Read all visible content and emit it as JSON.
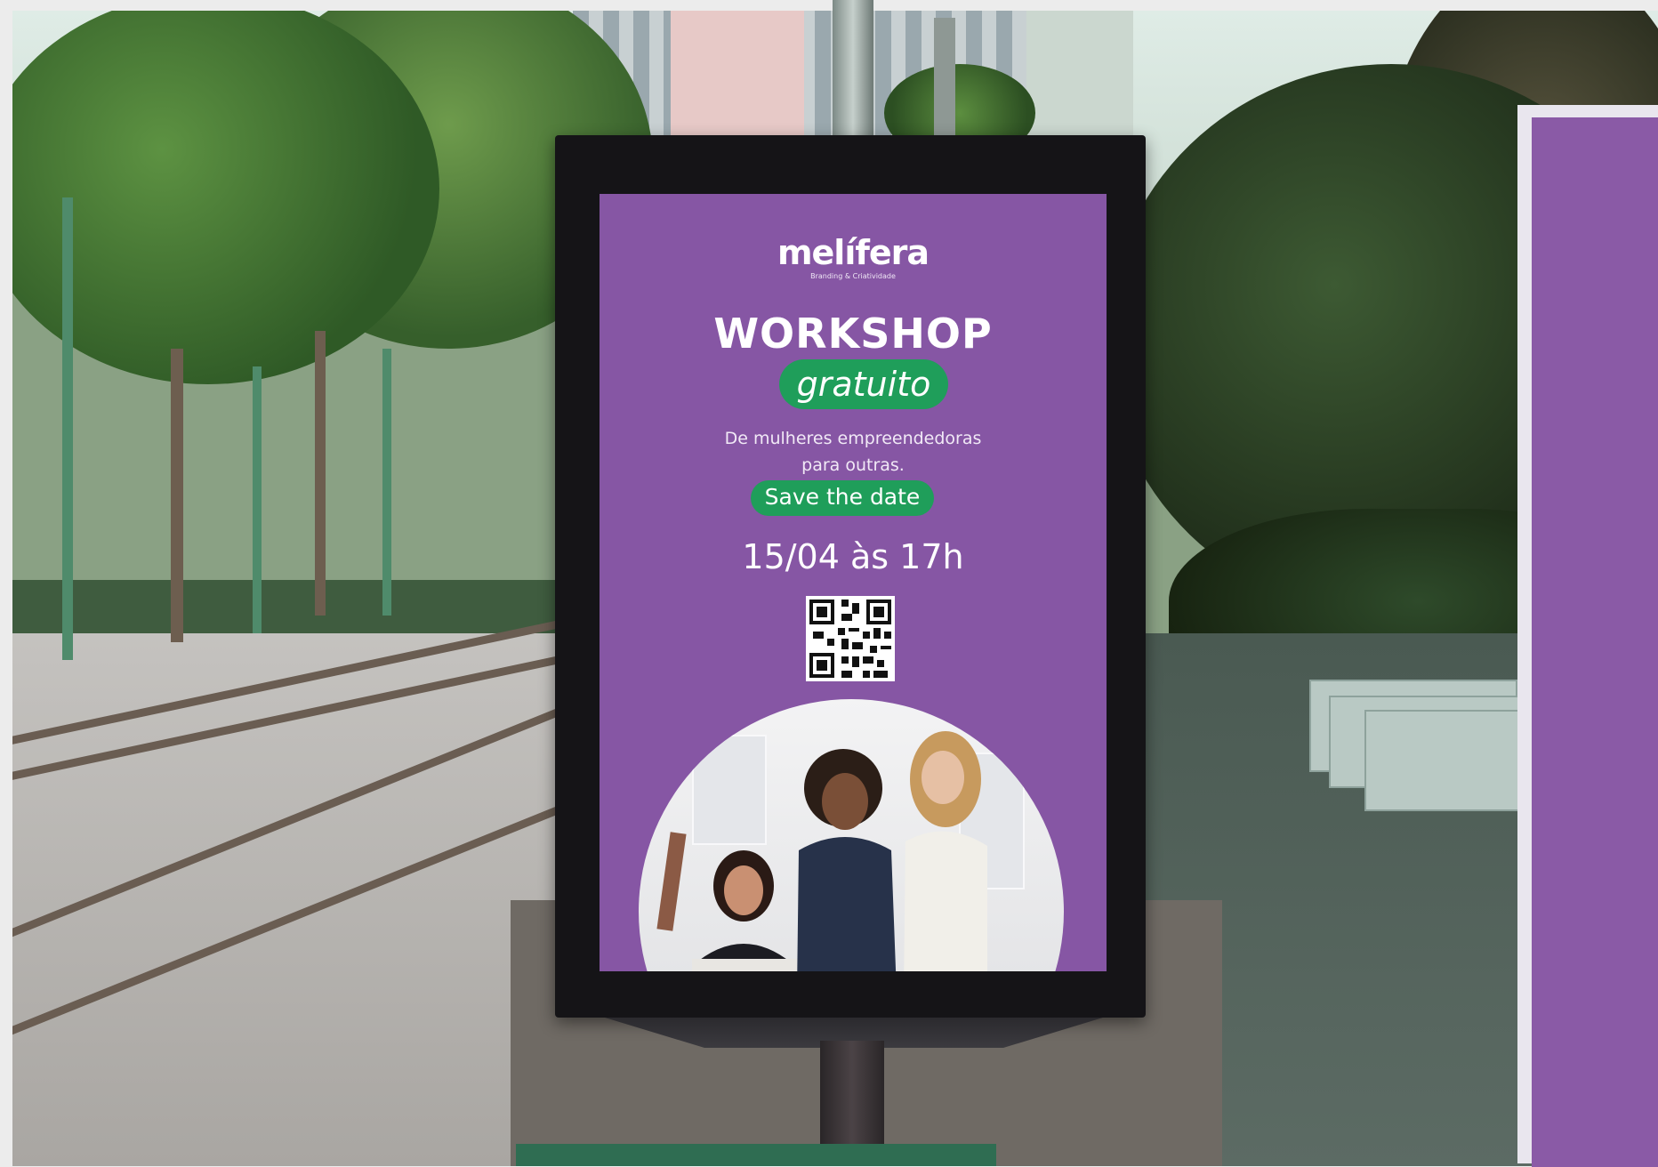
{
  "poster": {
    "logo": "melífera",
    "logo_subtitle": "Branding & Criatividade",
    "headline": "WORKSHOP",
    "headline_badge": "gratuito",
    "tagline_line1": "De mulheres empreendedoras",
    "tagline_line2": "para outras.",
    "cta_badge": "Save the date",
    "date_time": "15/04 às 17h"
  },
  "colors": {
    "poster_background": "#8656a4",
    "badge_green": "#1f9e5a",
    "frame": "#151417"
  },
  "scene": {
    "elements": [
      "trees",
      "tram-tracks",
      "sidewalk",
      "benches",
      "street-pole",
      "buildings"
    ],
    "qr_code_icon": "qr-code-icon"
  }
}
